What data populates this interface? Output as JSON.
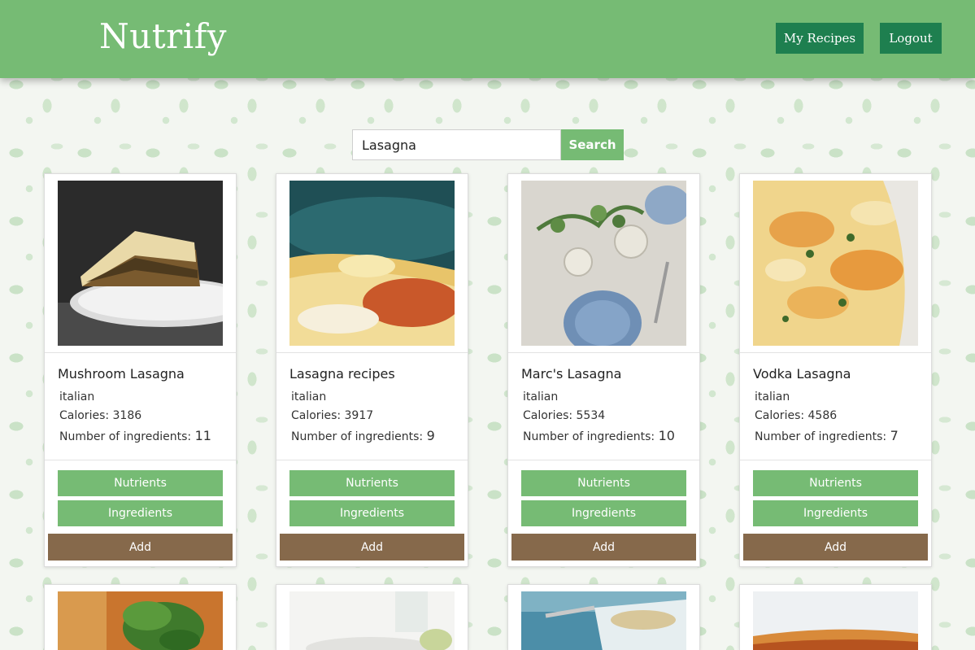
{
  "header": {
    "logo": "Nutrify",
    "my_recipes_label": "My Recipes",
    "logout_label": "Logout"
  },
  "search": {
    "value": "Lasagna",
    "button_label": "Search"
  },
  "recipes": [
    {
      "title": "Mushroom Lasagna",
      "cuisine": "italian",
      "calories": "Calories: 3186",
      "ingredients_label": "Number of ingredients:",
      "ingredients_count": "11",
      "image": "mushroom-lasagna-photo"
    },
    {
      "title": "Lasagna recipes",
      "cuisine": "italian",
      "calories": "Calories: 3917",
      "ingredients_label": "Number of ingredients:",
      "ingredients_count": "9",
      "image": "cheesy-lasagna-photo"
    },
    {
      "title": "Marc's Lasagna",
      "cuisine": "italian",
      "calories": "Calories: 5534",
      "ingredients_label": "Number of ingredients:",
      "ingredients_count": "10",
      "image": "table-setting-photo"
    },
    {
      "title": "Vodka Lasagna",
      "cuisine": "italian",
      "calories": "Calories: 4586",
      "ingredients_label": "Number of ingredients:",
      "ingredients_count": "7",
      "image": "baked-lasagna-dish-photo"
    }
  ],
  "card_buttons": {
    "nutrients": "Nutrients",
    "ingredients": "Ingredients",
    "add": "Add"
  },
  "colors": {
    "header_green": "#76bb74",
    "header_button": "#1e7f4f",
    "add_button": "#86694b"
  }
}
